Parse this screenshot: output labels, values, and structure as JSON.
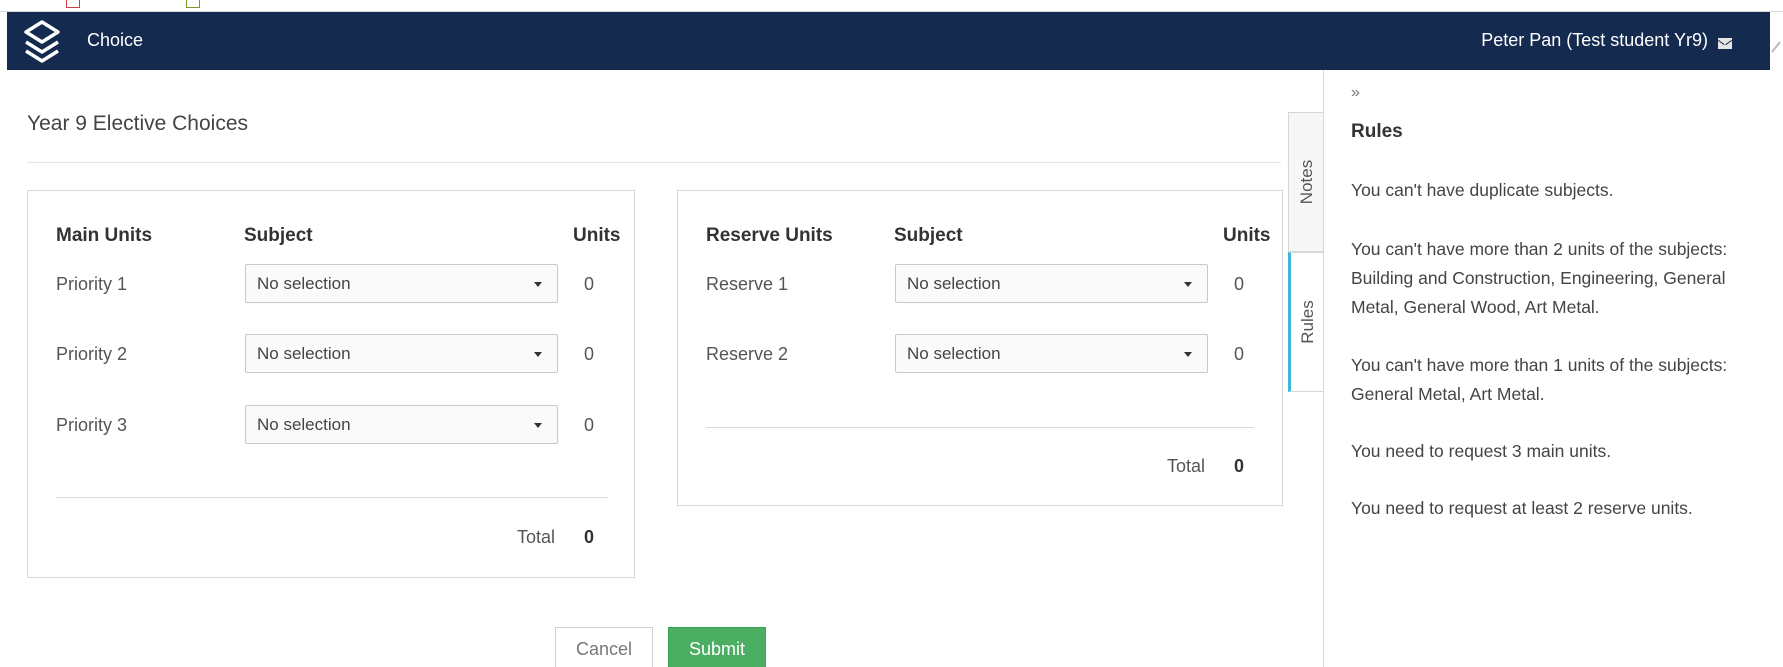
{
  "app": {
    "title": "Choice",
    "user": "Peter Pan (Test student Yr9)"
  },
  "page": {
    "title": "Year 9 Elective Choices"
  },
  "main_units": {
    "headers": {
      "label": "Main Units",
      "subject": "Subject",
      "units": "Units"
    },
    "rows": [
      {
        "label": "Priority 1",
        "subject": "No selection",
        "units": "0"
      },
      {
        "label": "Priority 2",
        "subject": "No selection",
        "units": "0"
      },
      {
        "label": "Priority 3",
        "subject": "No selection",
        "units": "0"
      }
    ],
    "total_label": "Total",
    "total_value": "0"
  },
  "reserve_units": {
    "headers": {
      "label": "Reserve Units",
      "subject": "Subject",
      "units": "Units"
    },
    "rows": [
      {
        "label": "Reserve 1",
        "subject": "No selection",
        "units": "0"
      },
      {
        "label": "Reserve 2",
        "subject": "No selection",
        "units": "0"
      }
    ],
    "total_label": "Total",
    "total_value": "0"
  },
  "actions": {
    "cancel": "Cancel",
    "submit": "Submit"
  },
  "side_tabs": {
    "notes": "Notes",
    "rules": "Rules",
    "active": "Rules"
  },
  "rules_panel": {
    "collapse_glyph": "»",
    "heading": "Rules",
    "items": [
      "You can't have duplicate subjects.",
      "You can't have more than 2 units of the subjects: Building and Construction, Engineering, General Metal, General Wood, Art Metal.",
      "You can't have more than 1 units of the subjects: General Metal, Art Metal.",
      "You need to request 3 main units.",
      "You need to request at least 2 reserve units."
    ]
  },
  "icons": {
    "brand": "layers-logo-icon",
    "mail": "mail-icon",
    "dropdown": "caret-down-icon",
    "collapse": "double-chevron-right-icon"
  },
  "colors": {
    "navbar": "#142a4e",
    "submit": "#4cae62",
    "active_tab_accent": "#3db7d8"
  }
}
